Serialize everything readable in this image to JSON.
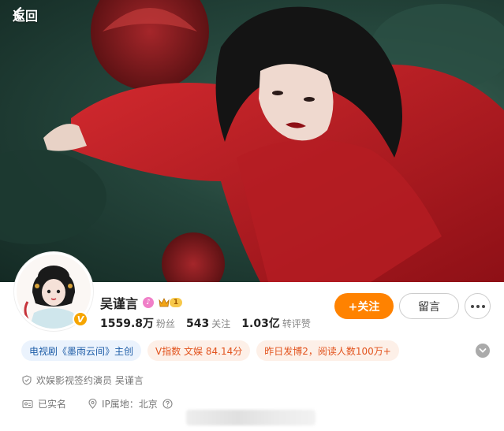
{
  "header": {
    "back_label": "返回"
  },
  "profile": {
    "name": "吴谨言",
    "level": "1",
    "verified_mark": "V",
    "stats": [
      {
        "value": "1559.8万",
        "label": "粉丝"
      },
      {
        "value": "543",
        "label": "关注"
      },
      {
        "value": "1.03亿",
        "label": "转评赞"
      }
    ]
  },
  "actions": {
    "follow_label": "+关注",
    "message_label": "留言"
  },
  "tags": [
    {
      "text": "电视剧《墨雨云间》主创",
      "tone": "blue"
    },
    {
      "text": "V指数 文娱 84.14分",
      "tone": "orange"
    },
    {
      "text": "昨日发博2，阅读人数100万+",
      "tone": "orange"
    }
  ],
  "info": {
    "verification": "欢娱影视签约演员 吴谨言",
    "real_name": "已实名",
    "ip_location": "IP属地：北京"
  },
  "colors": {
    "accent": "#ff8200",
    "tag_blue_text": "#1f5ea8",
    "tag_orange_text": "#e2531d"
  }
}
